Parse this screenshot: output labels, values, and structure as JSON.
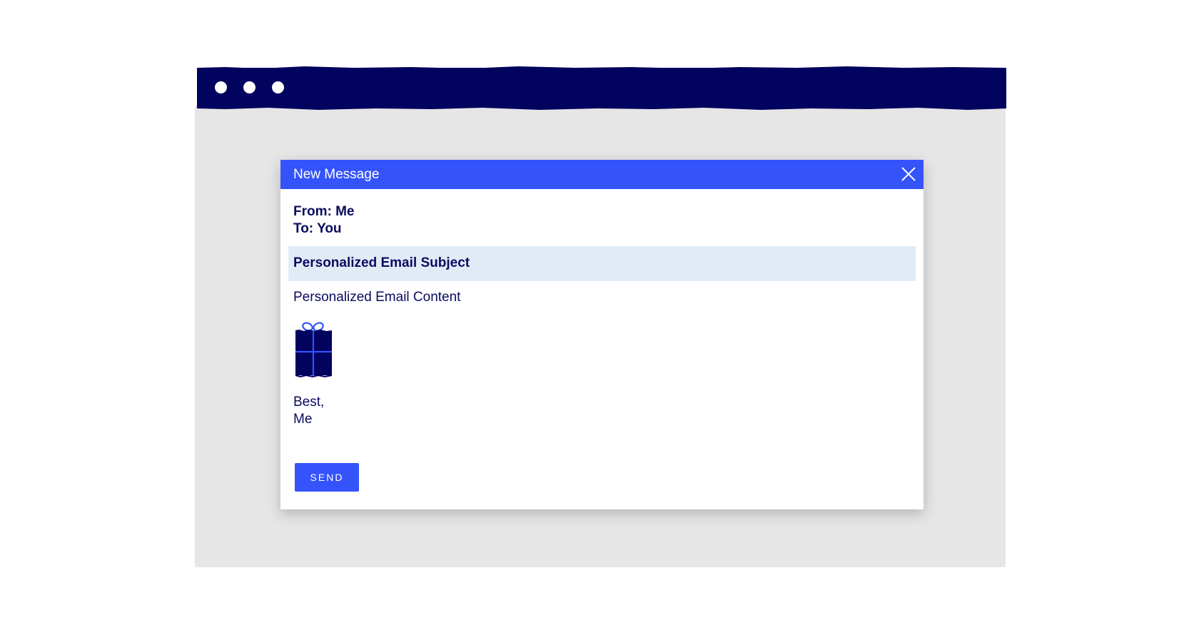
{
  "window": {
    "controls": [
      "dot-icon",
      "dot-icon",
      "dot-icon"
    ]
  },
  "dialog": {
    "title": "New Message",
    "close_icon": "close-icon",
    "from_line": "From: Me",
    "to_line": "To: You",
    "subject": "Personalized Email Subject",
    "content": "Personalized Email Content",
    "image_icon": "gift-icon",
    "signoff_line1": "Best,",
    "signoff_line2": "Me",
    "send_label": "SEND"
  },
  "colors": {
    "browser_bar": "#02025f",
    "browser_body": "#e6e6e6",
    "dialog_header": "#3553fb",
    "subject_highlight": "#e1ebf6",
    "text": "#0b0b5e",
    "accent": "#3553fb"
  }
}
